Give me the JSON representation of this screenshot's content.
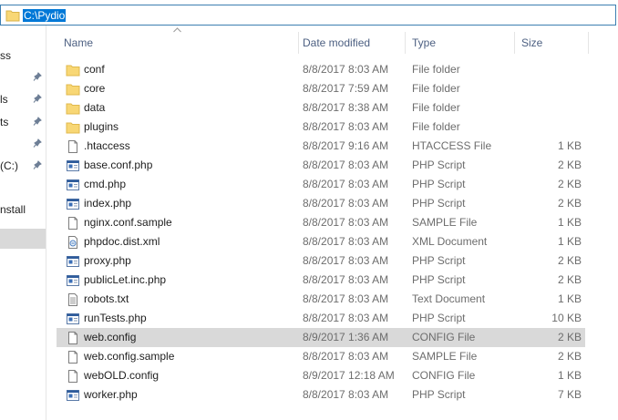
{
  "address": {
    "path": "C:\\Pydio"
  },
  "nav": {
    "items": [
      {
        "label": "ss",
        "pinned": false
      },
      {
        "label": "",
        "pinned": true
      },
      {
        "label": "ls",
        "pinned": true
      },
      {
        "label": "ts",
        "pinned": true
      },
      {
        "label": "",
        "pinned": true
      },
      {
        "label": "(C:)",
        "pinned": true
      },
      {
        "label": "",
        "pinned": false
      },
      {
        "label": "nstall",
        "pinned": false
      }
    ]
  },
  "columns": {
    "name": "Name",
    "date": "Date modified",
    "type": "Type",
    "size": "Size"
  },
  "files": [
    {
      "name": "conf",
      "date": "8/8/2017 8:03 AM",
      "type": "File folder",
      "size": "",
      "icon": "folder-icon"
    },
    {
      "name": "core",
      "date": "8/8/2017 7:59 AM",
      "type": "File folder",
      "size": "",
      "icon": "folder-icon"
    },
    {
      "name": "data",
      "date": "8/8/2017 8:38 AM",
      "type": "File folder",
      "size": "",
      "icon": "folder-icon"
    },
    {
      "name": "plugins",
      "date": "8/8/2017 8:03 AM",
      "type": "File folder",
      "size": "",
      "icon": "folder-icon"
    },
    {
      "name": ".htaccess",
      "date": "8/8/2017 9:16 AM",
      "type": "HTACCESS File",
      "size": "1 KB",
      "icon": "file-icon"
    },
    {
      "name": "base.conf.php",
      "date": "8/8/2017 8:03 AM",
      "type": "PHP Script",
      "size": "2 KB",
      "icon": "php-script-icon"
    },
    {
      "name": "cmd.php",
      "date": "8/8/2017 8:03 AM",
      "type": "PHP Script",
      "size": "2 KB",
      "icon": "php-script-icon"
    },
    {
      "name": "index.php",
      "date": "8/8/2017 8:03 AM",
      "type": "PHP Script",
      "size": "2 KB",
      "icon": "php-script-icon"
    },
    {
      "name": "nginx.conf.sample",
      "date": "8/8/2017 8:03 AM",
      "type": "SAMPLE File",
      "size": "1 KB",
      "icon": "file-icon"
    },
    {
      "name": "phpdoc.dist.xml",
      "date": "8/8/2017 8:03 AM",
      "type": "XML Document",
      "size": "1 KB",
      "icon": "xml-document-icon"
    },
    {
      "name": "proxy.php",
      "date": "8/8/2017 8:03 AM",
      "type": "PHP Script",
      "size": "2 KB",
      "icon": "php-script-icon"
    },
    {
      "name": "publicLet.inc.php",
      "date": "8/8/2017 8:03 AM",
      "type": "PHP Script",
      "size": "2 KB",
      "icon": "php-script-icon"
    },
    {
      "name": "robots.txt",
      "date": "8/8/2017 8:03 AM",
      "type": "Text Document",
      "size": "1 KB",
      "icon": "text-document-icon"
    },
    {
      "name": "runTests.php",
      "date": "8/8/2017 8:03 AM",
      "type": "PHP Script",
      "size": "10 KB",
      "icon": "php-script-icon"
    },
    {
      "name": "web.config",
      "date": "8/9/2017 1:36 AM",
      "type": "CONFIG File",
      "size": "2 KB",
      "icon": "file-icon",
      "selected": true
    },
    {
      "name": "web.config.sample",
      "date": "8/8/2017 8:03 AM",
      "type": "SAMPLE File",
      "size": "2 KB",
      "icon": "file-icon"
    },
    {
      "name": "webOLD.config",
      "date": "8/9/2017 12:18 AM",
      "type": "CONFIG File",
      "size": "1 KB",
      "icon": "file-icon"
    },
    {
      "name": "worker.php",
      "date": "8/8/2017 8:03 AM",
      "type": "PHP Script",
      "size": "7 KB",
      "icon": "php-script-icon"
    }
  ],
  "colors": {
    "selection": "#d9d9d9",
    "folder": "#f8d775",
    "accent": "#0078d7"
  }
}
